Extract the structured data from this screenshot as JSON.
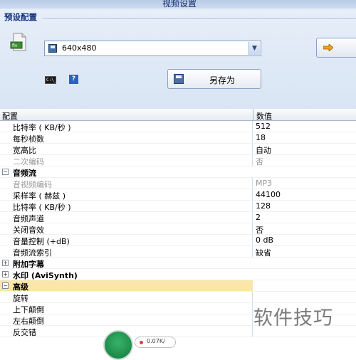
{
  "window": {
    "title": "视频设置"
  },
  "preset": {
    "group_title": "预设配置",
    "selected": "640x480",
    "save_as_label": "另存为",
    "cmd_icon_text": "C:\\_",
    "help_icon_text": "?"
  },
  "grid": {
    "headers": {
      "name": "配置",
      "value": "数值"
    },
    "rows": [
      {
        "type": "item",
        "name": "比特率 ( KB/秒 )",
        "value": "512",
        "disabled": false
      },
      {
        "type": "item",
        "name": "每秒桢数",
        "value": "18",
        "disabled": false
      },
      {
        "type": "item",
        "name": "宽高比",
        "value": "自动",
        "disabled": false
      },
      {
        "type": "item",
        "name": "二次编码",
        "value": "否",
        "disabled": true
      },
      {
        "type": "category",
        "name": "音频流",
        "expanded": true,
        "expander": "−"
      },
      {
        "type": "item",
        "name": "音视频编码",
        "value": "MP3",
        "disabled": true
      },
      {
        "type": "item",
        "name": "采样率 ( 赫兹 )",
        "value": "44100",
        "disabled": false
      },
      {
        "type": "item",
        "name": "比特率 ( KB/秒 )",
        "value": "128",
        "disabled": false
      },
      {
        "type": "item",
        "name": "音频声道",
        "value": "2",
        "disabled": false
      },
      {
        "type": "item",
        "name": "关闭音效",
        "value": "否",
        "disabled": false
      },
      {
        "type": "item",
        "name": "音量控制 (+dB)",
        "value": "0 dB",
        "disabled": false
      },
      {
        "type": "item",
        "name": "音频流索引",
        "value": "缺省",
        "disabled": false
      },
      {
        "type": "category",
        "name": "附加字幕",
        "expanded": false,
        "expander": "+"
      },
      {
        "type": "category",
        "name": "水印 (AviSynth)",
        "expanded": false,
        "expander": "+"
      },
      {
        "type": "category",
        "name": "高级",
        "expanded": true,
        "expander": "−",
        "selected": true
      },
      {
        "type": "item",
        "name": "旋转",
        "value": "",
        "disabled": false
      },
      {
        "type": "item",
        "name": "上下颠倒",
        "value": "",
        "disabled": false
      },
      {
        "type": "item",
        "name": "左右颠倒",
        "value": "",
        "disabled": false
      },
      {
        "type": "item",
        "name": "反交错",
        "value": "",
        "disabled": false
      }
    ]
  },
  "watermark_text": "软件技巧",
  "footer": {
    "pill_text": "0.07K/"
  },
  "colors": {
    "selected_row": "#fae6a8",
    "panel_bg": "#dde8f5",
    "title_text": "#0e2f78"
  }
}
